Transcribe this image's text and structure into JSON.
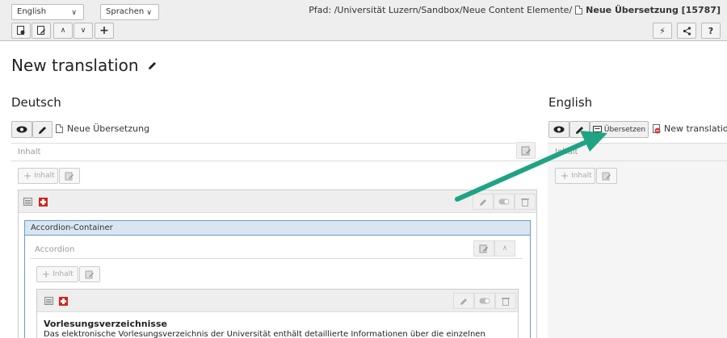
{
  "toolbar": {
    "language_select": "English",
    "sprachen_select": "Sprachen",
    "path_label": "Pfad: /Universität Luzern/Sandbox/Neue Content Elemente/",
    "path_page": "Neue Übersetzung [15787]"
  },
  "page": {
    "title": "New translation"
  },
  "left": {
    "heading": "Deutsch",
    "page_name": "Neue Übersetzung",
    "inhalt_label": "Inhalt",
    "add_content_label": "Inhalt",
    "accordion_container_title": "Accordion-Container",
    "accordion_label": "Accordion",
    "accordion_add_label": "Inhalt",
    "element_title": "Vorlesungsverzeichnisse",
    "element_text": "Das  elektronische Vorlesungsverzeichnis der Universität enthält detaillierte Informationen über die einzelnen"
  },
  "right": {
    "heading": "English",
    "translate_button": "Übersetzen",
    "page_name": "New translation",
    "inhalt_label": "Inhalt",
    "add_content_label": "Inhalt"
  },
  "colors": {
    "arrow": "#1fa383",
    "container_header": "#d9e6f2",
    "container_border": "#6f9ac6"
  }
}
